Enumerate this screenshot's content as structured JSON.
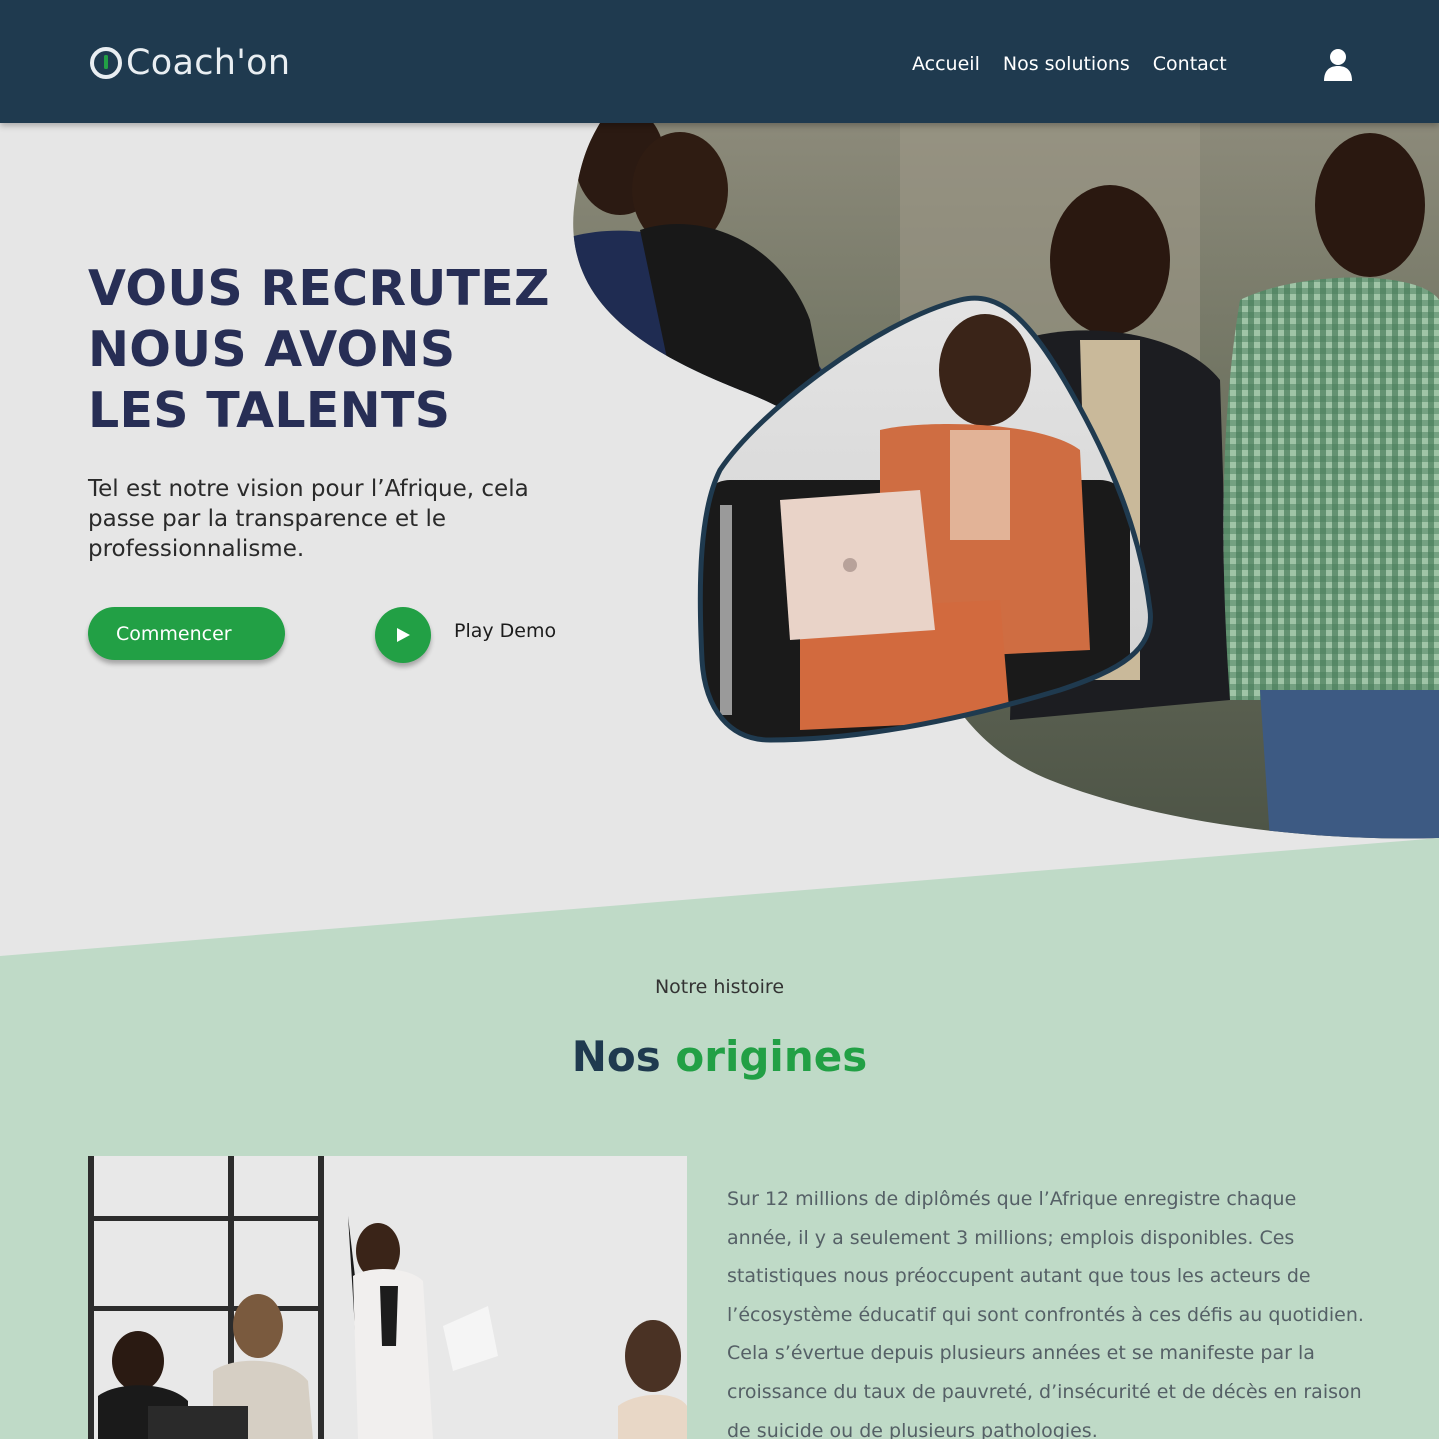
{
  "header": {
    "brand": "Coach'on",
    "nav": [
      "Accueil",
      "Nos solutions",
      "Contact"
    ],
    "user_icon": "user-icon"
  },
  "hero": {
    "title_lines": [
      "VOUS RECRUTEZ",
      "NOUS AVONS",
      "LES TALENTS"
    ],
    "subtitle": "Tel est notre vision pour l’Afrique, cela passe par la transparence et le professionnalisme.",
    "cta_label": "Commencer",
    "play_label": "Play Demo",
    "play_icon": "play-icon"
  },
  "origins": {
    "kicker": "Notre histoire",
    "title_part1": "Nos",
    "title_part2": "origines",
    "body": "Sur 12 millions de diplômés que l’Afrique enregistre chaque année, il y a seulement 3 millions; emplois disponibles. Ces statistiques nous préoccupent autant que tous les acteurs de l’écosystème éducatif qui sont confrontés à ces défis au quotidien. Cela s’évertue depuis plusieurs années et se manifeste par la croissance du taux de pauvreté, d’insécurité et de décès en raison de suicide ou de plusieurs pathologies."
  },
  "colors": {
    "header_bg": "#1f3a4f",
    "hero_bg": "#e6e6e6",
    "section_bg": "#bfdac7",
    "accent_green": "#22a045",
    "title_navy": "#272e55"
  }
}
